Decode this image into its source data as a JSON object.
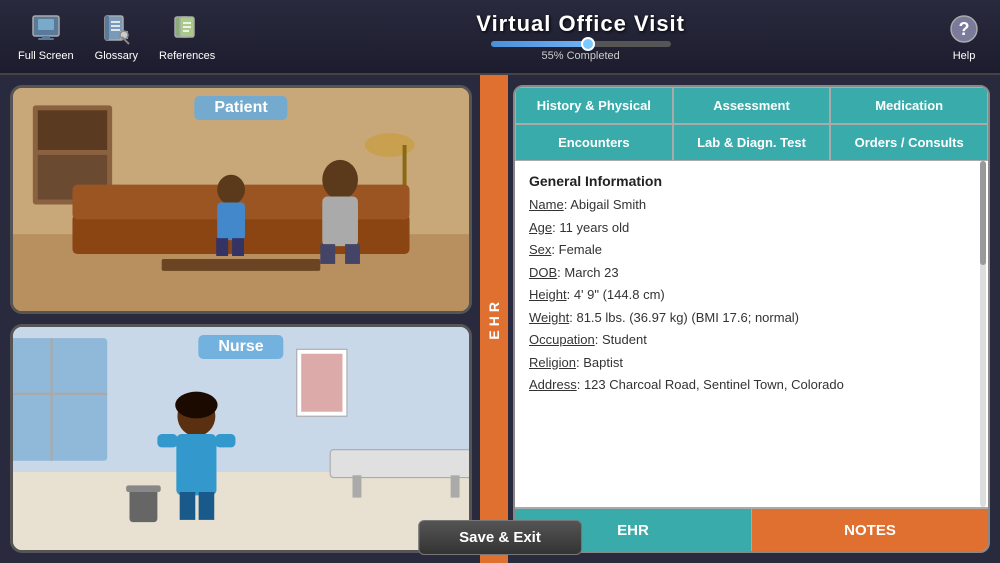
{
  "header": {
    "title": "Virtual Office Visit",
    "progress_label": "55% Completed",
    "progress_pct": 55
  },
  "toolbar": {
    "fullscreen_label": "Full Screen",
    "glossary_label": "Glossary",
    "references_label": "References",
    "help_label": "Help"
  },
  "left_panel": {
    "patient_label": "Patient",
    "nurse_label": "Nurse"
  },
  "ehr_sidebar": {
    "label": "E\nH\nR"
  },
  "ehr": {
    "tabs": [
      {
        "id": "history",
        "label": "History & Physical",
        "active": true
      },
      {
        "id": "assessment",
        "label": "Assessment",
        "active": false
      },
      {
        "id": "medication",
        "label": "Medication",
        "active": false
      },
      {
        "id": "encounters",
        "label": "Encounters",
        "active": false
      },
      {
        "id": "lab",
        "label": "Lab & Diagn. Test",
        "active": false
      },
      {
        "id": "orders",
        "label": "Orders / Consults",
        "active": false
      }
    ],
    "content": {
      "section_title": "General Information",
      "fields": [
        {
          "label": "Name",
          "value": "Abigail Smith"
        },
        {
          "label": "Age",
          "value": "11 years old"
        },
        {
          "label": "Sex",
          "value": "Female"
        },
        {
          "label": "DOB",
          "value": "March 23"
        },
        {
          "label": "Height",
          "value": "4' 9\" (144.8 cm)"
        },
        {
          "label": "Weight",
          "value": "81.5 lbs. (36.97 kg) (BMI 17.6; normal)"
        },
        {
          "label": "Occupation",
          "value": "Student"
        },
        {
          "label": "Religion",
          "value": "Baptist"
        },
        {
          "label": "Address",
          "value": "123 Charcoal Road, Sentinel Town, Colorado"
        }
      ]
    },
    "btn_ehr": "EHR",
    "btn_notes": "NOTES"
  },
  "footer": {
    "save_exit_label": "Save & Exit"
  }
}
